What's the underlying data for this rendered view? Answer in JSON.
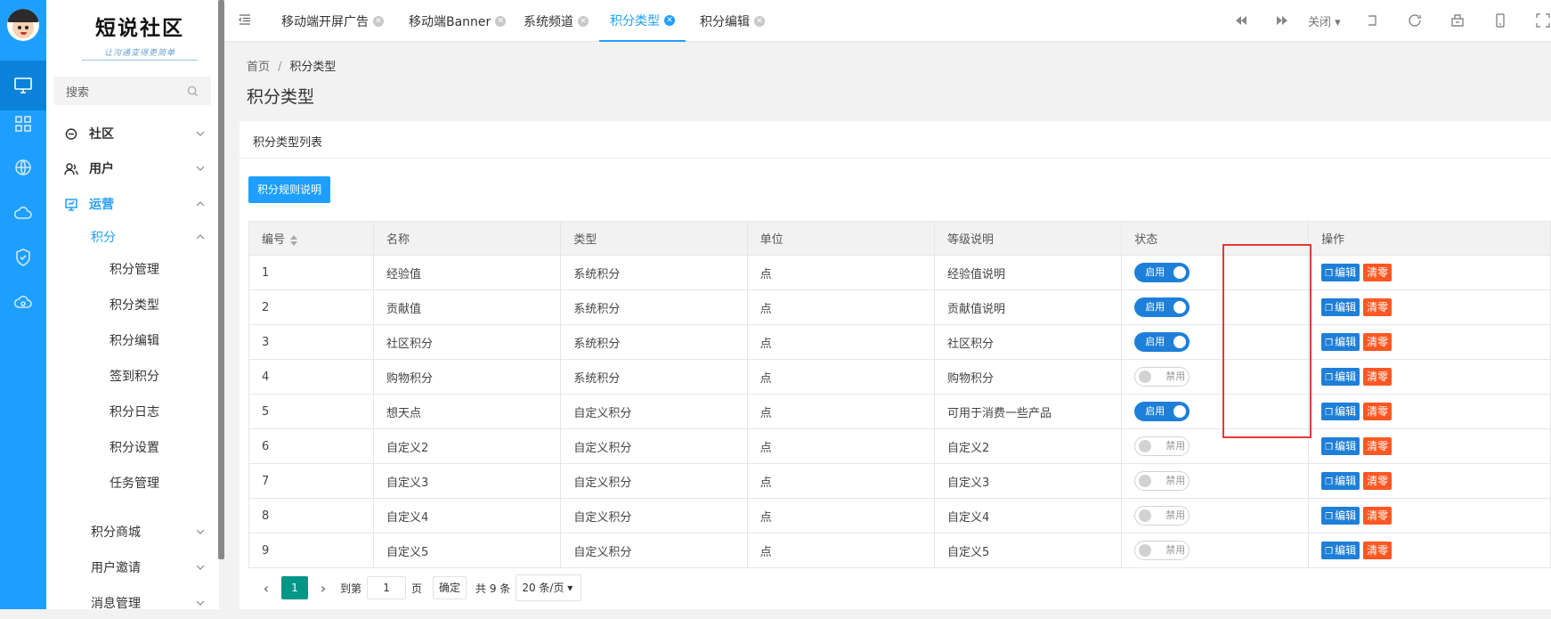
{
  "app": {
    "logo_main": "短说社区",
    "logo_sub": "让沟通变得更简单"
  },
  "rail": {
    "items": [
      {
        "icon": "monitor-icon",
        "active": true
      },
      {
        "icon": "grid-icon",
        "active": false
      },
      {
        "icon": "globe-icon",
        "active": false
      },
      {
        "icon": "cloud-icon",
        "active": false
      },
      {
        "icon": "shield-check-icon",
        "active": false
      },
      {
        "icon": "cloud-sync-icon",
        "active": false
      }
    ]
  },
  "sidebar": {
    "search_placeholder": "搜索",
    "menu": [
      {
        "label": "社区",
        "icon": "chat-icon"
      },
      {
        "label": "用户",
        "icon": "users-icon"
      },
      {
        "label": "运营",
        "icon": "presentation-icon"
      }
    ],
    "sub_open": "积分",
    "leaves": [
      "积分管理",
      "积分类型",
      "积分编辑",
      "签到积分",
      "积分日志",
      "积分设置",
      "任务管理"
    ],
    "sub_more": [
      "积分商城",
      "用户邀请",
      "消息管理"
    ]
  },
  "tabs": [
    {
      "label": "移动端开屏广告",
      "active": false
    },
    {
      "label": "移动端Banner",
      "active": false
    },
    {
      "label": "系统频道",
      "active": false
    },
    {
      "label": "积分类型",
      "active": true
    },
    {
      "label": "积分编辑",
      "active": false
    }
  ],
  "toolbar": {
    "close_label": "关闭"
  },
  "breadcrumb": {
    "home": "首页",
    "sep": "/",
    "current": "积分类型"
  },
  "page": {
    "title": "积分类型",
    "card_title": "积分类型列表",
    "rule_button": "积分规则说明"
  },
  "table": {
    "columns": [
      "编号",
      "名称",
      "类型",
      "单位",
      "等级说明",
      "状态",
      "操作"
    ],
    "rows": [
      {
        "id": "1",
        "name": "经验值",
        "type": "系统积分",
        "unit": "点",
        "desc": "经验值说明",
        "enabled": true
      },
      {
        "id": "2",
        "name": "贡献值",
        "type": "系统积分",
        "unit": "点",
        "desc": "贡献值说明",
        "enabled": true
      },
      {
        "id": "3",
        "name": "社区积分",
        "type": "系统积分",
        "unit": "点",
        "desc": "社区积分",
        "enabled": true
      },
      {
        "id": "4",
        "name": "购物积分",
        "type": "系统积分",
        "unit": "点",
        "desc": "购物积分",
        "enabled": false
      },
      {
        "id": "5",
        "name": "想天点",
        "type": "自定义积分",
        "unit": "点",
        "desc": "可用于消费一些产品",
        "enabled": true
      },
      {
        "id": "6",
        "name": "自定义2",
        "type": "自定义积分",
        "unit": "点",
        "desc": "自定义2",
        "enabled": false
      },
      {
        "id": "7",
        "name": "自定义3",
        "type": "自定义积分",
        "unit": "点",
        "desc": "自定义3",
        "enabled": false
      },
      {
        "id": "8",
        "name": "自定义4",
        "type": "自定义积分",
        "unit": "点",
        "desc": "自定义4",
        "enabled": false
      },
      {
        "id": "9",
        "name": "自定义5",
        "type": "自定义积分",
        "unit": "点",
        "desc": "自定义5",
        "enabled": false
      }
    ],
    "on_label": "启用",
    "off_label": "禁用",
    "edit_label": "编辑",
    "clear_label": "清零"
  },
  "pager": {
    "current_page": "1",
    "goto_prefix": "到第",
    "goto_value": "1",
    "goto_suffix": "页",
    "confirm": "确定",
    "total": "共 9 条",
    "page_size": "20 条/页"
  },
  "colors": {
    "primary": "#1e9fff",
    "switch_on": "#1e7fd8",
    "danger": "#ff5722",
    "page_active": "#009688",
    "highlight": "#e53935"
  }
}
